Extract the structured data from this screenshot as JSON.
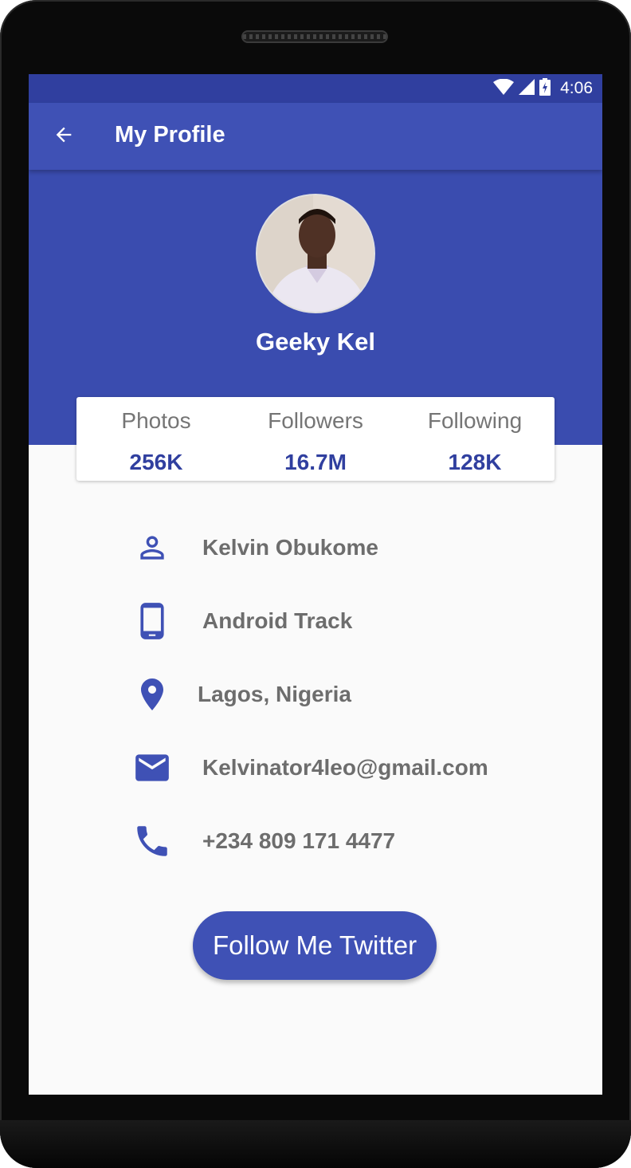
{
  "status_bar": {
    "time": "4:06",
    "icons": [
      "wifi-icon",
      "signal-icon",
      "battery-charging-icon"
    ]
  },
  "app_bar": {
    "back_icon": "arrow-back-icon",
    "title": "My Profile"
  },
  "profile": {
    "name": "Geeky Kel",
    "avatar": "profile-photo"
  },
  "stats": [
    {
      "label": "Photos",
      "value": "256K"
    },
    {
      "label": "Followers",
      "value": "16.7M"
    },
    {
      "label": "Following",
      "value": "128K"
    }
  ],
  "details": [
    {
      "icon": "person-icon",
      "text": "Kelvin Obukome"
    },
    {
      "icon": "smartphone-icon",
      "text": "Android Track"
    },
    {
      "icon": "location-pin-icon",
      "text": "Lagos, Nigeria"
    },
    {
      "icon": "mail-icon",
      "text": "Kelvinator4leo@gmail.com"
    },
    {
      "icon": "phone-icon",
      "text": "+234 809 171 4477"
    }
  ],
  "follow_button": {
    "label": "Follow Me Twitter"
  },
  "colors": {
    "primary": "#3f51b5",
    "primary_dark": "#303f9f",
    "background": "#fafafa",
    "text_secondary": "#6d6d6d"
  }
}
